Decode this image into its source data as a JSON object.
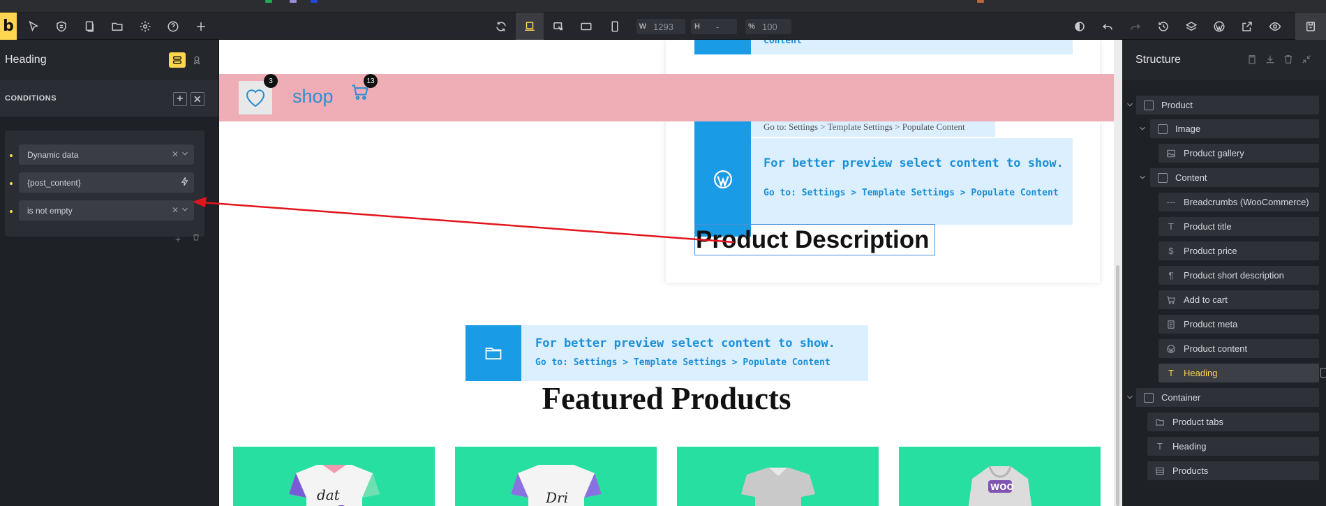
{
  "toolbar": {
    "logo": "b",
    "width_label": "W",
    "width_value": "1293",
    "height_label": "H",
    "height_value": "-",
    "zoom_label": "%",
    "zoom_value": "100"
  },
  "left_panel": {
    "title": "Heading",
    "conditions_label": "CONDITIONS",
    "conditions": [
      {
        "value": "Dynamic data"
      },
      {
        "value": "{post_content}"
      },
      {
        "value": "is not empty"
      }
    ]
  },
  "canvas": {
    "notice_partial": "content",
    "badge_heart": "3",
    "shop_label": "shop",
    "badge_cart": "13",
    "obscured_text": "Go to: Settings > Template Settings > Populate Content",
    "notice_title": "For better preview select content to show.",
    "notice_sub": "Go to: Settings > Template Settings > Populate Content",
    "product_description": "Product Description",
    "notice2_title": "For better preview select content to show.",
    "notice2_sub": "Go to: Settings > Template Settings > Populate Content",
    "featured_title": "Featured Products"
  },
  "structure": {
    "title": "Structure",
    "items": [
      {
        "label": "Product"
      },
      {
        "label": "Image"
      },
      {
        "label": "Product gallery"
      },
      {
        "label": "Content"
      },
      {
        "label": "Breadcrumbs (WooCommerce)"
      },
      {
        "label": "Product title"
      },
      {
        "label": "Product price"
      },
      {
        "label": "Product short description"
      },
      {
        "label": "Add to cart"
      },
      {
        "label": "Product meta"
      },
      {
        "label": "Product content"
      },
      {
        "label": "Heading"
      },
      {
        "label": "Container"
      },
      {
        "label": "Product tabs"
      },
      {
        "label": "Heading"
      },
      {
        "label": "Products"
      }
    ]
  },
  "colors": {
    "accent": "#ffd64f",
    "pink_bar": "#efadb6",
    "notice_blue": "#1a9be6",
    "tile_green": "#27dfa0",
    "arrow_red": "#e3141b"
  }
}
